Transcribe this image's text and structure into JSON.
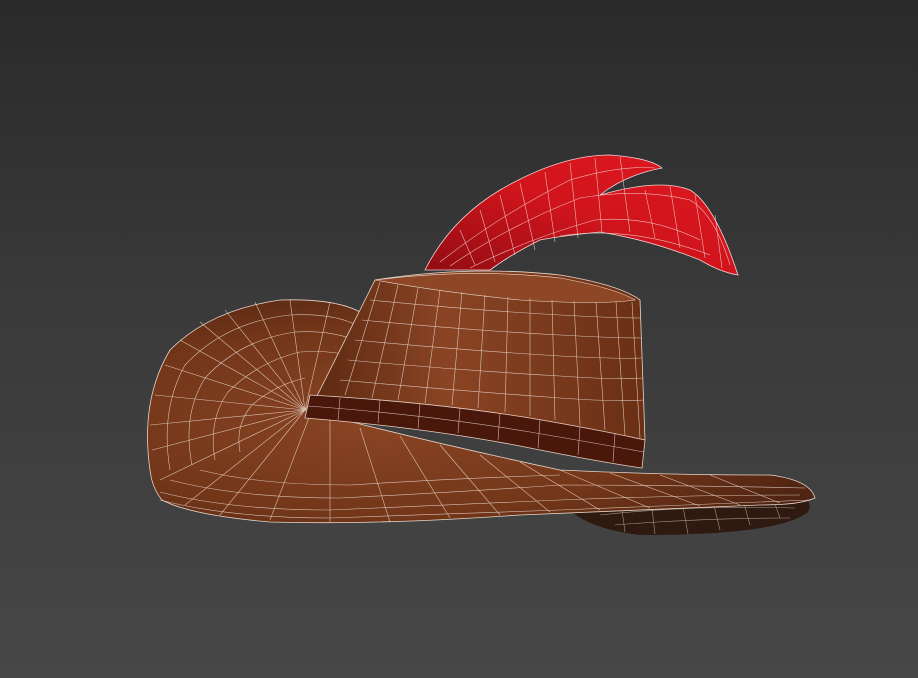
{
  "scene": {
    "object": "wireframe-hat-model",
    "colors": {
      "background_top": "#2a2a2a",
      "background_bottom": "#474747",
      "hat_brown": "#7a3b1c",
      "hat_dark": "#4d2210",
      "band": "#3d1208",
      "feather_red": "#c8121a",
      "wire": "#e8d8cc"
    }
  }
}
